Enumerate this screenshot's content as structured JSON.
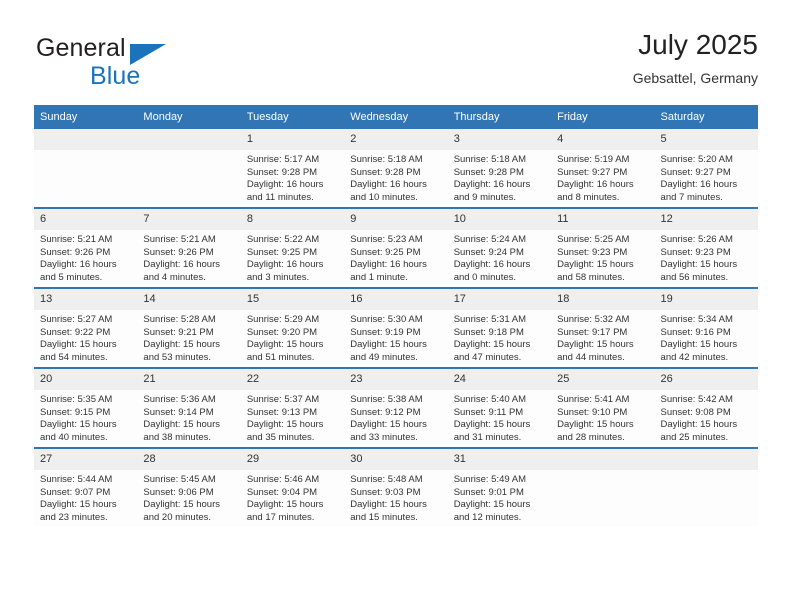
{
  "brand": {
    "name_top": "General",
    "name_bottom": "Blue",
    "triangle_icon": "brand-triangle-icon",
    "accent_color": "#1b74bb"
  },
  "header": {
    "title": "July 2025",
    "subtitle": "Gebsattel, Germany"
  },
  "calendar": {
    "header_color": "#3175b4",
    "daynum_band_color": "#efefef",
    "weekdays": [
      "Sunday",
      "Monday",
      "Tuesday",
      "Wednesday",
      "Thursday",
      "Friday",
      "Saturday"
    ],
    "labels": {
      "sunrise": "Sunrise:",
      "sunset": "Sunset:",
      "daylight": "Daylight:"
    },
    "weeks": [
      [
        {
          "day": "",
          "empty": true
        },
        {
          "day": "",
          "empty": true
        },
        {
          "day": "1",
          "sunrise": "Sunrise: 5:17 AM",
          "sunset": "Sunset: 9:28 PM",
          "daylight_1": "Daylight: 16 hours",
          "daylight_2": "and 11 minutes."
        },
        {
          "day": "2",
          "sunrise": "Sunrise: 5:18 AM",
          "sunset": "Sunset: 9:28 PM",
          "daylight_1": "Daylight: 16 hours",
          "daylight_2": "and 10 minutes."
        },
        {
          "day": "3",
          "sunrise": "Sunrise: 5:18 AM",
          "sunset": "Sunset: 9:28 PM",
          "daylight_1": "Daylight: 16 hours",
          "daylight_2": "and 9 minutes."
        },
        {
          "day": "4",
          "sunrise": "Sunrise: 5:19 AM",
          "sunset": "Sunset: 9:27 PM",
          "daylight_1": "Daylight: 16 hours",
          "daylight_2": "and 8 minutes."
        },
        {
          "day": "5",
          "sunrise": "Sunrise: 5:20 AM",
          "sunset": "Sunset: 9:27 PM",
          "daylight_1": "Daylight: 16 hours",
          "daylight_2": "and 7 minutes."
        }
      ],
      [
        {
          "day": "6",
          "sunrise": "Sunrise: 5:21 AM",
          "sunset": "Sunset: 9:26 PM",
          "daylight_1": "Daylight: 16 hours",
          "daylight_2": "and 5 minutes."
        },
        {
          "day": "7",
          "sunrise": "Sunrise: 5:21 AM",
          "sunset": "Sunset: 9:26 PM",
          "daylight_1": "Daylight: 16 hours",
          "daylight_2": "and 4 minutes."
        },
        {
          "day": "8",
          "sunrise": "Sunrise: 5:22 AM",
          "sunset": "Sunset: 9:25 PM",
          "daylight_1": "Daylight: 16 hours",
          "daylight_2": "and 3 minutes."
        },
        {
          "day": "9",
          "sunrise": "Sunrise: 5:23 AM",
          "sunset": "Sunset: 9:25 PM",
          "daylight_1": "Daylight: 16 hours",
          "daylight_2": "and 1 minute."
        },
        {
          "day": "10",
          "sunrise": "Sunrise: 5:24 AM",
          "sunset": "Sunset: 9:24 PM",
          "daylight_1": "Daylight: 16 hours",
          "daylight_2": "and 0 minutes."
        },
        {
          "day": "11",
          "sunrise": "Sunrise: 5:25 AM",
          "sunset": "Sunset: 9:23 PM",
          "daylight_1": "Daylight: 15 hours",
          "daylight_2": "and 58 minutes."
        },
        {
          "day": "12",
          "sunrise": "Sunrise: 5:26 AM",
          "sunset": "Sunset: 9:23 PM",
          "daylight_1": "Daylight: 15 hours",
          "daylight_2": "and 56 minutes."
        }
      ],
      [
        {
          "day": "13",
          "sunrise": "Sunrise: 5:27 AM",
          "sunset": "Sunset: 9:22 PM",
          "daylight_1": "Daylight: 15 hours",
          "daylight_2": "and 54 minutes."
        },
        {
          "day": "14",
          "sunrise": "Sunrise: 5:28 AM",
          "sunset": "Sunset: 9:21 PM",
          "daylight_1": "Daylight: 15 hours",
          "daylight_2": "and 53 minutes."
        },
        {
          "day": "15",
          "sunrise": "Sunrise: 5:29 AM",
          "sunset": "Sunset: 9:20 PM",
          "daylight_1": "Daylight: 15 hours",
          "daylight_2": "and 51 minutes."
        },
        {
          "day": "16",
          "sunrise": "Sunrise: 5:30 AM",
          "sunset": "Sunset: 9:19 PM",
          "daylight_1": "Daylight: 15 hours",
          "daylight_2": "and 49 minutes."
        },
        {
          "day": "17",
          "sunrise": "Sunrise: 5:31 AM",
          "sunset": "Sunset: 9:18 PM",
          "daylight_1": "Daylight: 15 hours",
          "daylight_2": "and 47 minutes."
        },
        {
          "day": "18",
          "sunrise": "Sunrise: 5:32 AM",
          "sunset": "Sunset: 9:17 PM",
          "daylight_1": "Daylight: 15 hours",
          "daylight_2": "and 44 minutes."
        },
        {
          "day": "19",
          "sunrise": "Sunrise: 5:34 AM",
          "sunset": "Sunset: 9:16 PM",
          "daylight_1": "Daylight: 15 hours",
          "daylight_2": "and 42 minutes."
        }
      ],
      [
        {
          "day": "20",
          "sunrise": "Sunrise: 5:35 AM",
          "sunset": "Sunset: 9:15 PM",
          "daylight_1": "Daylight: 15 hours",
          "daylight_2": "and 40 minutes."
        },
        {
          "day": "21",
          "sunrise": "Sunrise: 5:36 AM",
          "sunset": "Sunset: 9:14 PM",
          "daylight_1": "Daylight: 15 hours",
          "daylight_2": "and 38 minutes."
        },
        {
          "day": "22",
          "sunrise": "Sunrise: 5:37 AM",
          "sunset": "Sunset: 9:13 PM",
          "daylight_1": "Daylight: 15 hours",
          "daylight_2": "and 35 minutes."
        },
        {
          "day": "23",
          "sunrise": "Sunrise: 5:38 AM",
          "sunset": "Sunset: 9:12 PM",
          "daylight_1": "Daylight: 15 hours",
          "daylight_2": "and 33 minutes."
        },
        {
          "day": "24",
          "sunrise": "Sunrise: 5:40 AM",
          "sunset": "Sunset: 9:11 PM",
          "daylight_1": "Daylight: 15 hours",
          "daylight_2": "and 31 minutes."
        },
        {
          "day": "25",
          "sunrise": "Sunrise: 5:41 AM",
          "sunset": "Sunset: 9:10 PM",
          "daylight_1": "Daylight: 15 hours",
          "daylight_2": "and 28 minutes."
        },
        {
          "day": "26",
          "sunrise": "Sunrise: 5:42 AM",
          "sunset": "Sunset: 9:08 PM",
          "daylight_1": "Daylight: 15 hours",
          "daylight_2": "and 25 minutes."
        }
      ],
      [
        {
          "day": "27",
          "sunrise": "Sunrise: 5:44 AM",
          "sunset": "Sunset: 9:07 PM",
          "daylight_1": "Daylight: 15 hours",
          "daylight_2": "and 23 minutes."
        },
        {
          "day": "28",
          "sunrise": "Sunrise: 5:45 AM",
          "sunset": "Sunset: 9:06 PM",
          "daylight_1": "Daylight: 15 hours",
          "daylight_2": "and 20 minutes."
        },
        {
          "day": "29",
          "sunrise": "Sunrise: 5:46 AM",
          "sunset": "Sunset: 9:04 PM",
          "daylight_1": "Daylight: 15 hours",
          "daylight_2": "and 17 minutes."
        },
        {
          "day": "30",
          "sunrise": "Sunrise: 5:48 AM",
          "sunset": "Sunset: 9:03 PM",
          "daylight_1": "Daylight: 15 hours",
          "daylight_2": "and 15 minutes."
        },
        {
          "day": "31",
          "sunrise": "Sunrise: 5:49 AM",
          "sunset": "Sunset: 9:01 PM",
          "daylight_1": "Daylight: 15 hours",
          "daylight_2": "and 12 minutes."
        },
        {
          "day": "",
          "empty": true
        },
        {
          "day": "",
          "empty": true
        }
      ]
    ]
  }
}
